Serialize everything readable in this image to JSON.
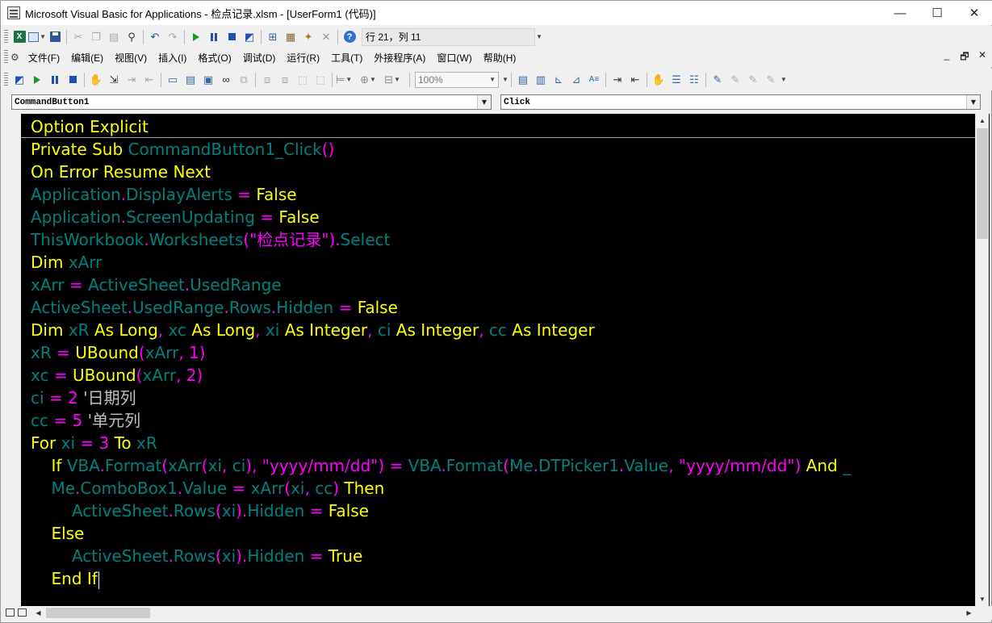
{
  "window": {
    "title": "Microsoft Visual Basic for Applications - 检点记录.xlsm - [UserForm1 (代码)]",
    "minimize": "—",
    "maximize": "☐",
    "close": "✕"
  },
  "standard_toolbar": {
    "position_text": "行 21，列 11"
  },
  "menu": {
    "items": [
      "文件(F)",
      "编辑(E)",
      "视图(V)",
      "插入(I)",
      "格式(O)",
      "调试(D)",
      "运行(R)",
      "工具(T)",
      "外接程序(A)",
      "窗口(W)",
      "帮助(H)"
    ],
    "doc_min": "_",
    "doc_restore": "🗗",
    "doc_close": "✕"
  },
  "edit_toolbar": {
    "zoom": "100%"
  },
  "code_window": {
    "object_combo": "CommandButton1",
    "procedure_combo": "Click"
  },
  "code_lines": [
    "Option Explicit",
    "Private Sub CommandButton1_Click()",
    "On Error Resume Next",
    "Application.DisplayAlerts = False",
    "Application.ScreenUpdating = False",
    "ThisWorkbook.Worksheets(\"检点记录\").Select",
    "Dim xArr",
    "xArr = ActiveSheet.UsedRange",
    "ActiveSheet.UsedRange.Rows.Hidden = False",
    "Dim xR As Long, xc As Long, xi As Integer, ci As Integer, cc As Integer",
    "xR = UBound(xArr, 1)",
    "xc = UBound(xArr, 2)",
    "ci = 2 '日期列",
    "cc = 5 '单元列",
    "For xi = 3 To xR",
    "    If VBA.Format(xArr(xi, ci), \"yyyy/mm/dd\") = VBA.Format(Me.DTPicker1.Value, \"yyyy/mm/dd\") And _",
    "    Me.ComboBox1.Value = xArr(xi, cc) Then",
    "        ActiveSheet.Rows(xi).Hidden = False",
    "    Else",
    "        ActiveSheet.Rows(xi).Hidden = True",
    "    End If"
  ],
  "colors": {
    "background": "#000000",
    "keyword": "#ffff00",
    "identifier": "#008080",
    "operator": "#ff00ff",
    "comment": "#c0c0c0"
  }
}
